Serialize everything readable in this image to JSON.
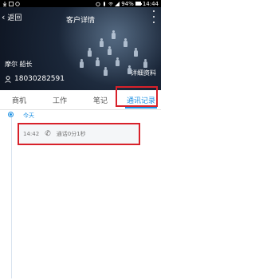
{
  "status_bar": {
    "battery": "94%",
    "time": "14:44"
  },
  "header": {
    "back_label": "返回",
    "title": "客户详情"
  },
  "profile": {
    "name": "摩尔 船长",
    "phone": "18030282591",
    "detail_link": "详细资料"
  },
  "tabs": [
    {
      "label": "商机",
      "active": false
    },
    {
      "label": "工作",
      "active": false
    },
    {
      "label": "笔记",
      "active": false
    },
    {
      "label": "通讯记录",
      "active": true
    }
  ],
  "timeline": {
    "day_label": "今天",
    "records": [
      {
        "time": "14:42",
        "icon": "phone-icon",
        "text": "通话0分1秒"
      }
    ]
  },
  "colors": {
    "accent": "#1a8fe3",
    "highlight": "#d8212a"
  }
}
